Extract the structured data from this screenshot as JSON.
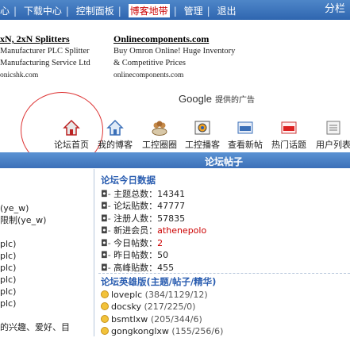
{
  "topbar": {
    "links": [
      "心",
      "下载中心",
      "控制面板",
      "博客地带",
      "管理",
      "退出"
    ],
    "highlight_index": 3,
    "right_label": "分栏"
  },
  "ads": [
    {
      "title": "xN, 2xN Splitters",
      "lines": [
        "Manufacturer PLC Splitter",
        "Manufacturing Service Ltd"
      ],
      "url": "onicshk.com"
    },
    {
      "title": "Onlinecomponents.com",
      "lines": [
        "Buy Omron Online! Huge Inventory",
        "& Competitive Prices"
      ],
      "url": "onlinecomponents.com"
    }
  ],
  "google": {
    "logo": "Google",
    "text": "提供的广告"
  },
  "nav": [
    {
      "label": "论坛首页",
      "icon": "home-icon"
    },
    {
      "label": "我的博客",
      "icon": "blog-home-icon"
    },
    {
      "label": "工控圈圈",
      "icon": "group-icon"
    },
    {
      "label": "工控播客",
      "icon": "video-icon"
    },
    {
      "label": "查看新帖",
      "icon": "new-posts-icon"
    },
    {
      "label": "热门话题",
      "icon": "hot-topics-icon"
    },
    {
      "label": "用户列表",
      "icon": "user-list-icon"
    }
  ],
  "bar_title": "论坛帖子",
  "left_items": [
    "",
    "(ye_w)",
    "限制(ye_w)",
    "",
    "plc)",
    "plc)",
    "plc)",
    "plc)",
    "plc)",
    "plc)",
    "",
    "的兴趣、爱好、目"
  ],
  "stats": {
    "heading": "论坛今日数据",
    "rows": [
      {
        "label": "主题总数",
        "value": "14341"
      },
      {
        "label": "论坛贴数",
        "value": "47777"
      },
      {
        "label": "注册人数",
        "value": "57835"
      },
      {
        "label": "新进会员",
        "value": "athenepolo"
      },
      {
        "label": "今日帖数",
        "value": "2"
      },
      {
        "label": "昨日帖数",
        "value": "50"
      },
      {
        "label": "高峰贴数",
        "value": "455"
      }
    ]
  },
  "heroes": {
    "heading": "论坛英雄版(主题/帖子/精华)",
    "rows": [
      {
        "name": "loveplc",
        "stats": "(384/1129/12)"
      },
      {
        "name": "docsky",
        "stats": "(217/225/0)"
      },
      {
        "name": "bsmtlxw",
        "stats": "(205/344/6)"
      },
      {
        "name": "gongkonglxw",
        "stats": "(155/256/6)"
      }
    ]
  },
  "colors": {
    "topbar": "#3a72ba",
    "accent": "#2a5db0",
    "highlight": "#cc0000"
  }
}
